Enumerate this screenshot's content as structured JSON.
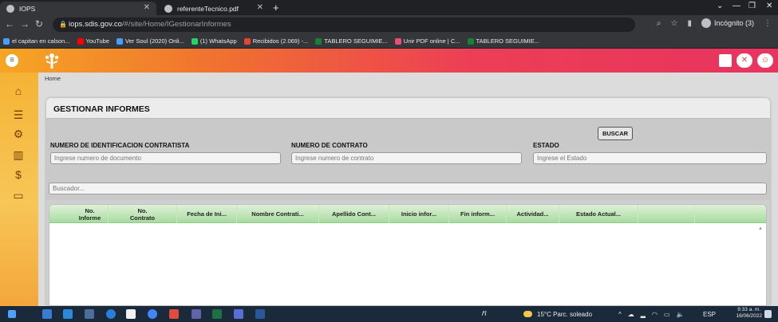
{
  "browser": {
    "tabs": [
      {
        "label": "IOPS",
        "active": true
      },
      {
        "label": "referenteTecnico.pdf",
        "active": false
      }
    ],
    "address": {
      "host": "iops.sdis.gov.co",
      "path": "/#/site/Home/IGestionarInformes"
    },
    "profile_label": "Incógnito (3)",
    "bookmarks": [
      {
        "label": "el capitan en calson...",
        "color": "#4a9df8"
      },
      {
        "label": "YouTube",
        "color": "#ff0000"
      },
      {
        "label": "Ver Soul (2020) Onli...",
        "color": "#4a9df8"
      },
      {
        "label": "(1) WhatsApp",
        "color": "#25d366"
      },
      {
        "label": "Recibidos (2.069) -...",
        "color": "#ea4335"
      },
      {
        "label": "TABLERO SEGUIMIE...",
        "color": "#188038"
      },
      {
        "label": "Unir PDF online | C...",
        "color": "#e94e77"
      },
      {
        "label": "TABLERO SEGUIMIE...",
        "color": "#188038"
      }
    ]
  },
  "app": {
    "breadcrumb": "Home",
    "header_gradient": [
      "#f5a623",
      "#ec3f55"
    ],
    "rail_icons": [
      "home-icon",
      "list-icon",
      "gear-icon",
      "chart-icon",
      "dollar-icon",
      "book-icon"
    ]
  },
  "page": {
    "title": "GESTIONAR INFORMES",
    "search_button": "BUSCAR",
    "filters": [
      {
        "label": "NUMERO DE IDENTIFICACION CONTRATISTA",
        "placeholder": "Ingrese numero de documento"
      },
      {
        "label": "NUMERO DE CONTRATO",
        "placeholder": "Ingrese numero de contrato"
      },
      {
        "label": "ESTADO",
        "placeholder": "Ingrese el Estado"
      }
    ],
    "finder_placeholder": "Buscador...",
    "columns": [
      "No.\nInforme",
      "No.\nContrato",
      "Fecha de Ini...",
      "Nombre Contrati...",
      "Apellido Cont...",
      "Inicio infor...",
      "Fin inform...",
      "Actividad...",
      "Estado Actual..."
    ]
  },
  "taskbar": {
    "weather": "15°C  Parc. soleado",
    "language": "ESP",
    "time": "9:33 a. m.",
    "date": "16/06/2022"
  }
}
